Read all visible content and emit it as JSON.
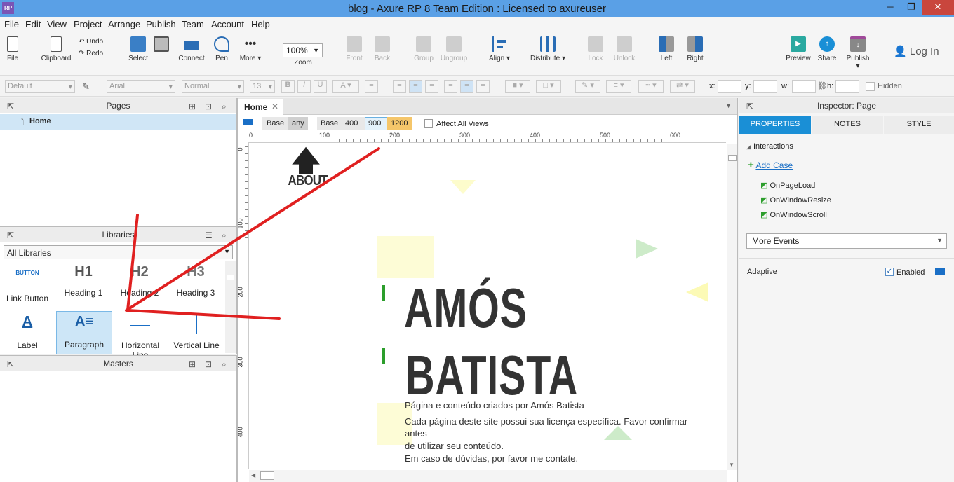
{
  "window": {
    "title": "blog - Axure RP 8 Team Edition : Licensed to axureuser",
    "logo": "RP"
  },
  "menu": [
    "File",
    "Edit",
    "View",
    "Project",
    "Arrange",
    "Publish",
    "Team",
    "Account",
    "Help"
  ],
  "toolbar": {
    "file": "File",
    "clipboard": "Clipboard",
    "undo": "Undo",
    "redo": "Redo",
    "select": "Select",
    "connect": "Connect",
    "pen": "Pen",
    "more": "More ▾",
    "zoom_value": "100%",
    "zoom": "Zoom",
    "front": "Front",
    "back": "Back",
    "group": "Group",
    "ungroup": "Ungroup",
    "align": "Align ▾",
    "distribute": "Distribute ▾",
    "lock": "Lock",
    "unlock": "Unlock",
    "left": "Left",
    "right": "Right",
    "preview": "Preview",
    "share": "Share",
    "publish": "Publish ▾",
    "login": "Log In"
  },
  "format": {
    "style": "Default",
    "font": "Arial",
    "weight": "Normal",
    "size": "13",
    "x": "x:",
    "y": "y:",
    "w": "w:",
    "h": "h:",
    "hidden": "Hidden"
  },
  "pages": {
    "title": "Pages",
    "items": [
      "Home"
    ]
  },
  "libraries": {
    "title": "Libraries",
    "selected": "All Libraries",
    "items": [
      {
        "icon": "BUTTON",
        "label": "Link Button"
      },
      {
        "icon": "H1",
        "label": "Heading 1"
      },
      {
        "icon": "H2",
        "label": "Heading 2"
      },
      {
        "icon": "H3",
        "label": "Heading 3"
      },
      {
        "icon": "A",
        "label": "Label"
      },
      {
        "icon": "A",
        "label": "Paragraph"
      },
      {
        "icon": "",
        "label": "Horizontal Line"
      },
      {
        "icon": "",
        "label": "Vertical Line"
      }
    ]
  },
  "masters": {
    "title": "Masters"
  },
  "canvas": {
    "tab": "Home",
    "base": "Base",
    "any": "any",
    "base2": "Base",
    "bp": [
      "400",
      "900",
      "1200"
    ],
    "affect": "Affect All Views",
    "ruler_h": [
      "0",
      "100",
      "200",
      "300",
      "400",
      "500",
      "600"
    ],
    "ruler_v": [
      "0",
      "100",
      "200",
      "300",
      "400"
    ],
    "about": "ABOUT",
    "name1": "AMÓS",
    "name2": "BATISTA",
    "p1": "Página e conteúdo criados por Amós Batista",
    "p2a": "Cada página deste site possui sua licença específica. Favor confirmar",
    "p2b": "antes",
    "p2c": "de utilizar seu conteúdo.",
    "p2d": "Em caso de dúvidas, por favor me contate."
  },
  "inspector": {
    "title": "Inspector: Page",
    "tabs": [
      "PROPERTIES",
      "NOTES",
      "STYLE"
    ],
    "interactions": "Interactions",
    "add_case": "Add Case",
    "events": [
      "OnPageLoad",
      "OnWindowResize",
      "OnWindowScroll"
    ],
    "more_events": "More Events",
    "adaptive": "Adaptive",
    "enabled": "Enabled"
  },
  "colors": {
    "accent": "#1a8fd6",
    "title_bar": "#5aa0e6",
    "annotation": "#e02020"
  }
}
